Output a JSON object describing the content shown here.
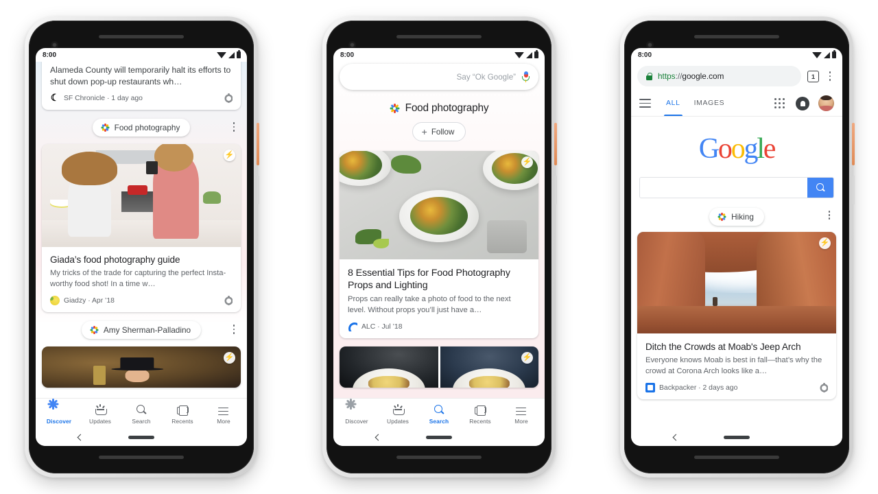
{
  "phones": [
    {
      "id": "phone-discover",
      "status": {
        "time": "8:00"
      },
      "partial_card": {
        "headline": "Alameda County will temporarily halt its efforts to shut down pop-up restaurants wh…",
        "source": "SF Chronicle · 1 day ago"
      },
      "chips": [
        {
          "label": "Food photography"
        },
        {
          "label": "Amy Sherman-Palladino"
        }
      ],
      "article": {
        "title": "Giada’s food photography guide",
        "snippet": "My tricks of the trade for capturing the perfect Insta-worthy food shot! In a time w…",
        "source": "Giadzy · Apr ’18"
      },
      "nav": {
        "items": [
          {
            "label": "Discover",
            "icon": "starburst-icon",
            "active": true
          },
          {
            "label": "Updates",
            "icon": "updates-icon",
            "active": false
          },
          {
            "label": "Search",
            "icon": "search-icon",
            "active": false
          },
          {
            "label": "Recents",
            "icon": "recents-icon",
            "active": false
          },
          {
            "label": "More",
            "icon": "more-icon",
            "active": false
          }
        ]
      }
    },
    {
      "id": "phone-topic",
      "status": {
        "time": "8:00"
      },
      "search": {
        "placeholder": "Say “Ok Google”",
        "mic_icon": "microphone-icon"
      },
      "topic": {
        "title": "Food photography",
        "follow_label": "Follow"
      },
      "article": {
        "title": "8 Essential Tips for Food Photography Props and Lighting",
        "snippet": "Props can really take a photo of food to the next level. Without props you’ll just have a…",
        "source": "ALC · Jul ’18"
      },
      "nav": {
        "items": [
          {
            "label": "Discover",
            "icon": "starburst-icon",
            "active": false
          },
          {
            "label": "Updates",
            "icon": "updates-icon",
            "active": false
          },
          {
            "label": "Search",
            "icon": "search-icon",
            "active": true
          },
          {
            "label": "Recents",
            "icon": "recents-icon",
            "active": false
          },
          {
            "label": "More",
            "icon": "more-icon",
            "active": false
          }
        ]
      }
    },
    {
      "id": "phone-browser",
      "status": {
        "time": "8:00"
      },
      "browser": {
        "url_scheme": "https",
        "url_sep": "://",
        "url_host": "google.com",
        "tab_count": "1",
        "lock_icon": "lock-icon",
        "menu_icon": "overflow-menu-icon"
      },
      "google_header": {
        "menu_icon": "hamburger-icon",
        "tabs": [
          {
            "label": "ALL",
            "active": true
          },
          {
            "label": "IMAGES",
            "active": false
          }
        ],
        "apps_icon": "apps-grid-icon",
        "notifications_icon": "bell-icon",
        "avatar_icon": "account-avatar"
      },
      "logo": {
        "letters": [
          "G",
          "o",
          "o",
          "g",
          "l",
          "e"
        ]
      },
      "search": {
        "value": "",
        "button_icon": "search-icon"
      },
      "chip": {
        "label": "Hiking"
      },
      "article": {
        "title": "Ditch the Crowds at Moab's Jeep Arch",
        "snippet": "Everyone knows Moab is best in fall—that’s why the crowd at Corona Arch looks like a…",
        "source": "Backpacker · 2 days ago"
      }
    }
  ],
  "colors": {
    "accent_blue": "#1a73e8",
    "google_blue": "#4285f4",
    "google_red": "#ea4335",
    "google_yellow": "#fbbc04",
    "google_green": "#34a853",
    "text_primary": "#202124",
    "text_secondary": "#5f6368",
    "lock_green": "#188038"
  },
  "badges": {
    "amp_glyph": "⚡"
  }
}
